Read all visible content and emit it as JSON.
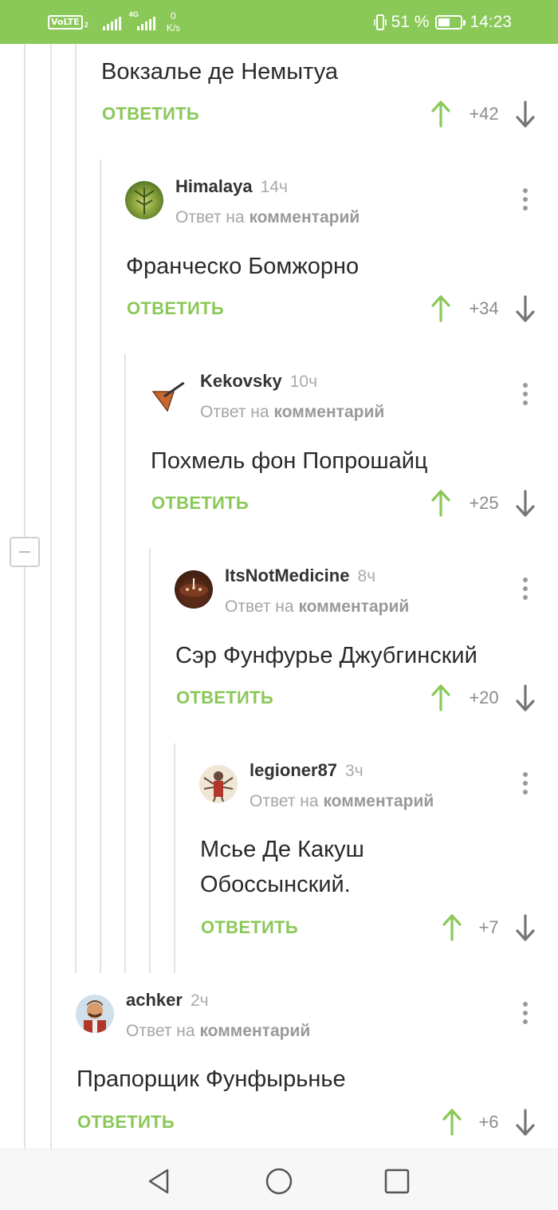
{
  "status_bar": {
    "volte": "VoLTE",
    "sim": "2",
    "network": "4G",
    "speed_value": "0",
    "speed_unit": "K/s",
    "battery": "51 %",
    "time": "14:23"
  },
  "thread": {
    "top_comment": {
      "text": "Вокзалье де Немытуа",
      "reply_label": "ОТВЕТИТЬ",
      "score": "+42"
    },
    "comments": [
      {
        "username": "Himalaya",
        "time": "14ч",
        "reply_prefix": "Ответ на",
        "reply_target": "комментарий",
        "text": "Франческо Бомжорно",
        "reply_label": "ОТВЕТИТЬ",
        "score": "+34"
      },
      {
        "username": "Kekovsky",
        "time": "10ч",
        "reply_prefix": "Ответ на",
        "reply_target": "комментарий",
        "text": "Похмель фон Попрошайц",
        "reply_label": "ОТВЕТИТЬ",
        "score": "+25"
      },
      {
        "username": "ItsNotMedicine",
        "time": "8ч",
        "reply_prefix": "Ответ на",
        "reply_target": "комментарий",
        "text": "Сэр Фунфурье Джубгинский",
        "reply_label": "ОТВЕТИТЬ",
        "score": "+20"
      },
      {
        "username": "legioner87",
        "time": "3ч",
        "reply_prefix": "Ответ на",
        "reply_target": "комментарий",
        "text_line1": "Мсье Де Какуш",
        "text_line2": "Обоссынский.",
        "reply_label": "ОТВЕТИТЬ",
        "score": "+7"
      },
      {
        "username": "achker",
        "time": "2ч",
        "reply_prefix": "Ответ на",
        "reply_target": "комментарий",
        "text": "Прапорщик Фунфырьнье",
        "reply_label": "ОТВЕТИТЬ",
        "score": "+6"
      }
    ]
  },
  "colors": {
    "accent": "#8ac858",
    "status_bar": "#8ac858",
    "muted_text": "#a5a5a5",
    "arrow": "#757575"
  },
  "icons": [
    "volte-icon",
    "signal-icon",
    "vibrate-icon",
    "battery-icon",
    "upvote-icon",
    "downvote-icon",
    "more-icon",
    "collapse-icon",
    "back-icon",
    "home-icon",
    "recents-icon"
  ]
}
